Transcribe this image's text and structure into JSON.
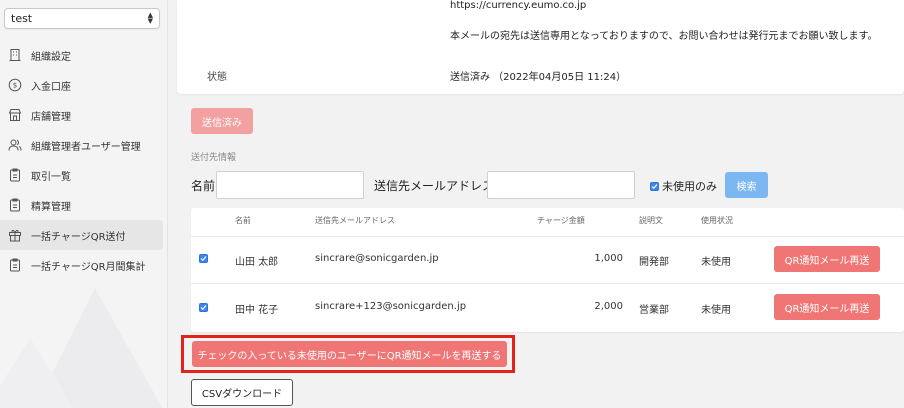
{
  "sidebar": {
    "org_select": "test",
    "items": [
      {
        "label": "組織設定",
        "icon": "building-icon",
        "active": false
      },
      {
        "label": "入金口座",
        "icon": "dollar-circle-icon",
        "active": false
      },
      {
        "label": "店舗管理",
        "icon": "store-icon",
        "active": false
      },
      {
        "label": "組織管理者ユーザー管理",
        "icon": "users-icon",
        "active": false
      },
      {
        "label": "取引一覧",
        "icon": "clipboard-icon",
        "active": false
      },
      {
        "label": "精算管理",
        "icon": "clipboard-icon",
        "active": false
      },
      {
        "label": "一括チャージQR送付",
        "icon": "gift-icon",
        "active": true
      },
      {
        "label": "一括チャージQR月間集計",
        "icon": "clipboard-icon",
        "active": false
      }
    ]
  },
  "detail": {
    "url_line": "https://currency.eumo.co.jp",
    "notice_line": "本メールの宛先は送信専用となっておりますので、お問い合わせは発行元までお願い致します。",
    "status_label": "状態",
    "status_value": "送信済み （2022年04月05日 11:24）"
  },
  "sent_button_label": "送信済み",
  "recipients": {
    "section_title": "送付先情報",
    "name_label": "名前",
    "email_label": "送信先メールアドレス",
    "name_value": "",
    "email_value": "",
    "unused_only_label": "未使用のみ",
    "search_button": "検索"
  },
  "table": {
    "headers": [
      "名前",
      "送信先メールアドレス",
      "チャージ金額",
      "説明文",
      "使用状況"
    ],
    "rows": [
      {
        "checked": true,
        "name": "山田 太郎",
        "email": "sincrare@sonicgarden.jp",
        "amount": "1,000",
        "description": "開発部",
        "status": "未使用",
        "action": "QR通知メール再送"
      },
      {
        "checked": true,
        "name": "田中 花子",
        "email": "sincrare+123@sonicgarden.jp",
        "amount": "2,000",
        "description": "営業部",
        "status": "未使用",
        "action": "QR通知メール再送"
      }
    ]
  },
  "bulk_resend_button": "チェックの入っている未使用のユーザーにQR通知メールを再送する",
  "csv_button": "CSVダウンロード",
  "colors": {
    "accent_red": "#f07676",
    "faded_red": "#f2a0a0",
    "search_blue": "#7db7f2",
    "highlight_border": "#e2231a",
    "checkbox_blue": "#3b86f0"
  }
}
